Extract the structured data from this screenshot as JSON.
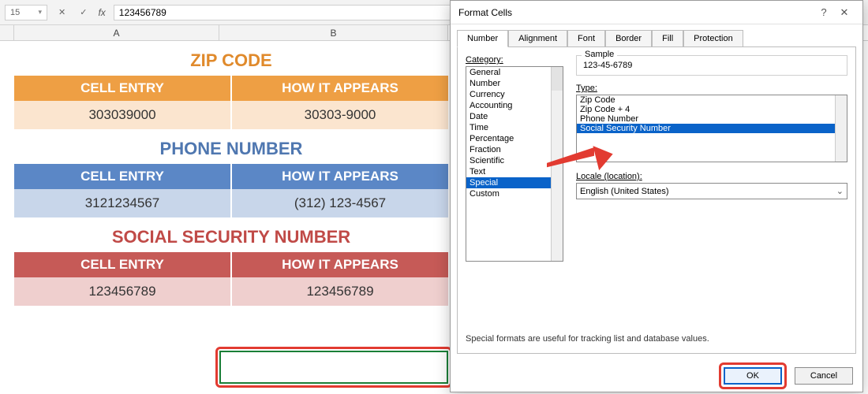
{
  "formula_bar": {
    "namebox": "15",
    "fx_label": "fx",
    "value": "123456789"
  },
  "column_headers": {
    "A": "A",
    "B": "B"
  },
  "sections": {
    "zip": {
      "title": "ZIP CODE",
      "hdr_entry": "CELL ENTRY",
      "hdr_appears": "HOW IT APPEARS",
      "entry": "303039000",
      "appears": "30303-9000"
    },
    "phone": {
      "title": "PHONE NUMBER",
      "hdr_entry": "CELL ENTRY",
      "hdr_appears": "HOW IT APPEARS",
      "entry": "3121234567",
      "appears": "(312) 123-4567"
    },
    "ssn": {
      "title": "SOCIAL SECURITY NUMBER",
      "hdr_entry": "CELL ENTRY",
      "hdr_appears": "HOW IT APPEARS",
      "entry": "123456789",
      "appears": "123456789"
    }
  },
  "dialog": {
    "title": "Format Cells",
    "tabs": {
      "number": "Number",
      "alignment": "Alignment",
      "font": "Font",
      "border": "Border",
      "fill": "Fill",
      "protection": "Protection"
    },
    "category_label": "Category:",
    "categories": [
      "General",
      "Number",
      "Currency",
      "Accounting",
      "Date",
      "Time",
      "Percentage",
      "Fraction",
      "Scientific",
      "Text",
      "Special",
      "Custom"
    ],
    "category_selected": "Special",
    "sample_label": "Sample",
    "sample_value": "123-45-6789",
    "type_label": "Type:",
    "types": [
      "Zip Code",
      "Zip Code + 4",
      "Phone Number",
      "Social Security Number"
    ],
    "type_selected": "Social Security Number",
    "locale_label": "Locale (location):",
    "locale_value": "English (United States)",
    "hint": "Special formats are useful for tracking list and database values.",
    "ok": "OK",
    "cancel": "Cancel"
  }
}
